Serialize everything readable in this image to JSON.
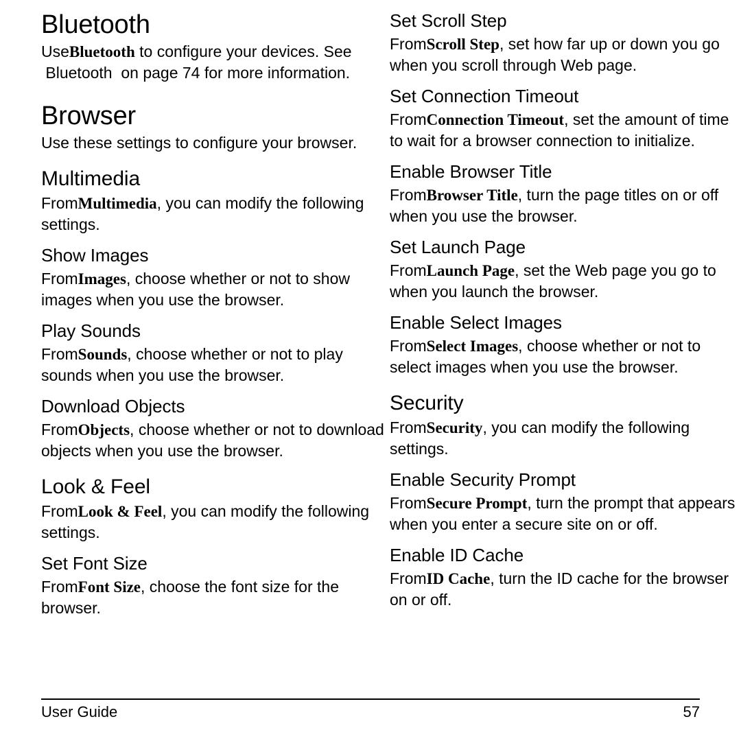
{
  "document": {
    "footer": {
      "left_label": "User Guide",
      "page_number": "57"
    }
  },
  "left_column": {
    "bluetooth": {
      "heading": "Bluetooth",
      "body_prefix": "Use",
      "body_term": "Bluetooth",
      "body_line1_rest": " to configure your devices. See",
      "body_line2": " Bluetooth  on page 74 for more information."
    },
    "browser": {
      "heading": "Browser",
      "body": "Use these settings to configure your browser."
    },
    "multimedia": {
      "heading": "Multimedia",
      "body_prefix": "From",
      "body_term": "Multimedia",
      "body_rest": ", you can modify the following settings."
    },
    "show_images": {
      "heading": "Show Images",
      "body_prefix": "From",
      "body_term": "Images",
      "body_rest": ", choose whether or not to show images when you use the browser."
    },
    "play_sounds": {
      "heading": "Play Sounds",
      "body_prefix": "From",
      "body_term": "Sounds",
      "body_rest": ", choose whether or not to play sounds when you use the browser."
    },
    "download_objects": {
      "heading": "Download Objects",
      "body_prefix": "From",
      "body_term": "Objects",
      "body_rest": ", choose whether or not to download objects when you use the browser."
    },
    "look_and_feel": {
      "heading": "Look & Feel",
      "body_prefix": "From",
      "body_term": "Look & Feel",
      "body_rest": ", you can modify the following settings."
    },
    "set_font_size": {
      "heading": "Set Font Size",
      "body_prefix": "From",
      "body_term": "Font Size",
      "body_rest": ", choose the font size for the browser."
    }
  },
  "right_column": {
    "set_scroll_step": {
      "heading": "Set Scroll Step",
      "body_prefix": "From",
      "body_term": "Scroll Step",
      "body_rest": ", set how far up or down you go when you scroll through Web page."
    },
    "set_connection_timeout": {
      "heading": "Set Connection Timeout",
      "body_prefix": "From",
      "body_term": "Connection Timeout",
      "body_rest": ", set the amount of time to wait for a browser connection to initialize."
    },
    "enable_browser_title": {
      "heading": "Enable Browser Title",
      "body_prefix": "From",
      "body_term": "Browser Title",
      "body_rest": ", turn the page titles on or off when you use the browser."
    },
    "set_launch_page": {
      "heading": "Set Launch Page",
      "body_prefix": "From",
      "body_term": "Launch Page",
      "body_rest": ", set the Web page you go to when you launch the browser."
    },
    "enable_select_images": {
      "heading": "Enable Select Images",
      "body_prefix": "From",
      "body_term": "Select Images",
      "body_rest": ", choose whether or not to select images when you use the browser."
    },
    "security": {
      "heading": "Security",
      "body_prefix": "From",
      "body_term": "Security",
      "body_rest": ", you can modify the following settings."
    },
    "enable_security_prompt": {
      "heading": "Enable Security Prompt",
      "body_prefix": "From",
      "body_term": "Secure Prompt",
      "body_rest": ", turn the prompt that appears when you enter a secure site on or off."
    },
    "enable_id_cache": {
      "heading": "Enable ID Cache",
      "body_prefix": "From",
      "body_term": "ID Cache",
      "body_rest": ", turn the ID cache for the browser on or off."
    }
  }
}
